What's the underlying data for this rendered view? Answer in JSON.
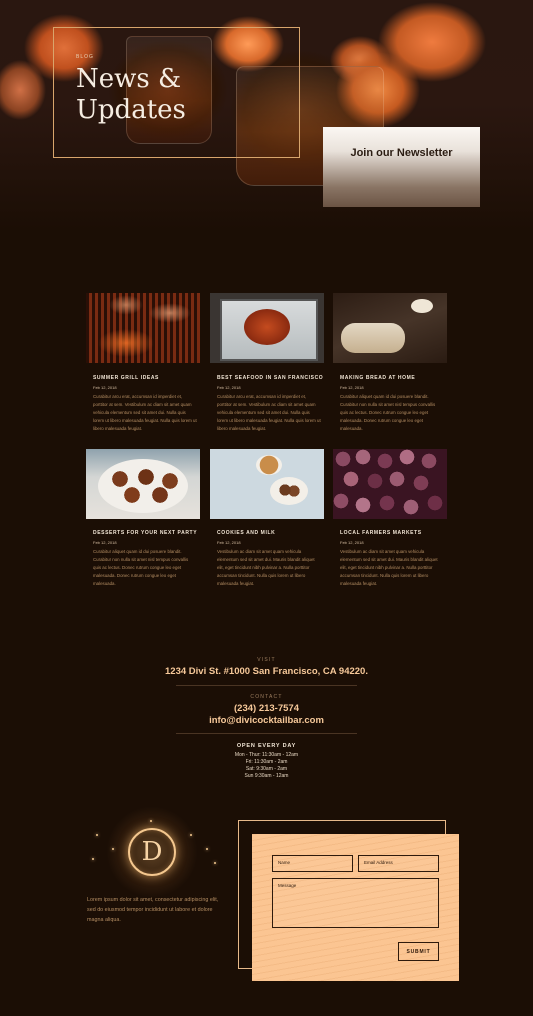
{
  "hero": {
    "eyebrow": "BLOG",
    "title": "News & Updates",
    "newsletter_label": "Join our Newsletter"
  },
  "posts": [
    {
      "title": "SUMMER GRILL IDEAS",
      "date": "Feb 12, 2018",
      "excerpt": "Curabitur arcu erat, accumsan id imperdiet et, porttitor at sem. Vestibulum ac diam sit amet quam vehicula elementum sed sit amet dui. Nulla quis lorem ut libero malesuada feugiat. Nulla quis lorem ut libero malesuada feugiat.",
      "image": "grill"
    },
    {
      "title": "BEST SEAFOOD IN SAN FRANCISCO",
      "date": "Feb 12, 2018",
      "excerpt": "Curabitur arcu erat, accumsan id imperdiet et, porttitor at sem. Vestibulum ac diam sit amet quam vehicula elementum sed sit amet dui. Nulla quis lorem ut libero malesuada feugiat. Nulla quis lorem ut libero malesuada feugiat.",
      "image": "crab"
    },
    {
      "title": "MAKING BREAD AT HOME",
      "date": "Feb 12, 2018",
      "excerpt": "Curabitur aliquet quam id dui posuere blandit. Curabitur non nulla sit amet nisl tempus convallis quis ac lectus. Donec rutrum congue leo eget malesuada. Donec rutrum congue leo eget malesuada.",
      "image": "bread"
    },
    {
      "title": "DESSERTS FOR YOUR NEXT PARTY",
      "date": "Feb 12, 2018",
      "excerpt": "Curabitur aliquet quam id dui posuere blandit. Curabitur non nulla sit amet nisl tempus convallis quis ac lectus. Donec rutrum congue leo eget malesuada. Donec rutrum congue leo eget malesuada.",
      "image": "dessert"
    },
    {
      "title": "COOKIES AND MILK",
      "date": "Feb 12, 2018",
      "excerpt": "Vestibulum ac diam sit amet quam vehicula elementum sed sit amet dui. Mauris blandit aliquet elit, eget tincidunt nibh pulvinar a. Nulla porttitor accumsan tincidunt. Nulla quis lorem ut libero malesuada feugiat.",
      "image": "cookies"
    },
    {
      "title": "LOCAL FARMERS MARKETS",
      "date": "Feb 12, 2018",
      "excerpt": "Vestibulum ac diam sit amet quam vehicula elementum sed sit amet dui. Mauris blandit aliquet elit, eget tincidunt nibh pulvinar a. Nulla porttitor accumsan tincidunt. Nulla quis lorem ut libero malesuada feugiat.",
      "image": "figs"
    }
  ],
  "contact": {
    "visit_label": "VISIT",
    "address": "1234 Divi St. #1000 San Francisco, CA 94220.",
    "contact_label": "CONTACT",
    "phone": "(234) 213-7574",
    "email": "info@divicocktailbar.com",
    "hours_title": "OPEN EVERY DAY",
    "hours": [
      "Mon - Thur: 11:30am - 12am",
      "Fri: 11:30am - 2am",
      "Sat: 9:30am - 2am",
      "Sun 9:30am - 12am"
    ]
  },
  "footer": {
    "logo_letter": "D",
    "text": "Lorem ipsum dolor sit amet, consectetur adipiscing elit, sed do eiusmod tempor incididunt ut labore et dolore magna aliqua."
  },
  "form": {
    "name_label": "Name",
    "email_label": "Email Address",
    "message_label": "Message",
    "submit_label": "SUBMIT"
  },
  "colors": {
    "background": "#1b0e05",
    "accent": "#f7c99a",
    "form_bg": "#fbc592"
  }
}
